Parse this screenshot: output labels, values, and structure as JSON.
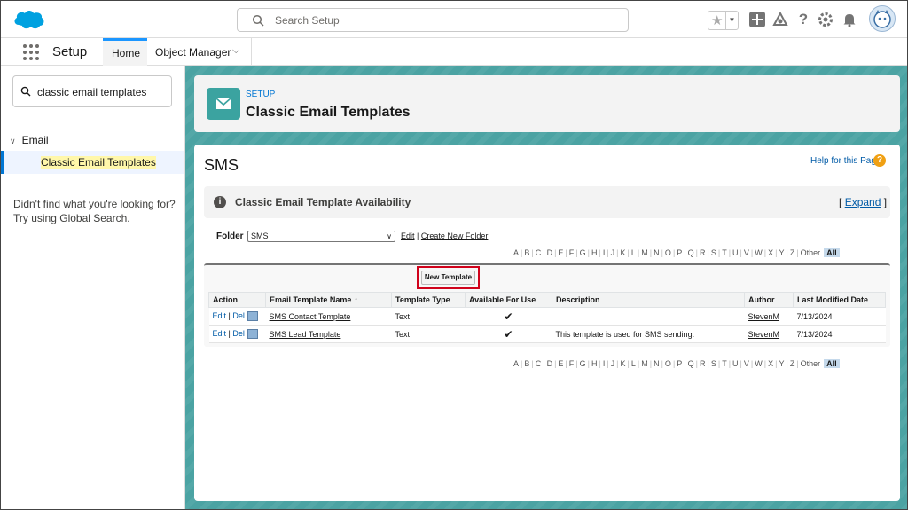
{
  "header": {
    "search_placeholder": "Search Setup"
  },
  "nav": {
    "app_title": "Setup",
    "tabs": [
      {
        "label": "Home"
      },
      {
        "label": "Object Manager"
      }
    ]
  },
  "sidebar": {
    "quick_find_value": "classic email templates",
    "group": "Email",
    "item": "Classic Email Templates",
    "not_found_line1": "Didn't find what you're looking for?",
    "not_found_line2": "Try using Global Search."
  },
  "page": {
    "eyebrow": "SETUP",
    "title": "Classic Email Templates",
    "section_title": "SMS",
    "help_link": "Help for this Page",
    "availability_title": "Classic Email Template Availability",
    "expand_open": "[",
    "expand_label": "Expand",
    "expand_close": "]",
    "folder_label": "Folder",
    "folder_value": "SMS",
    "folder_edit": "Edit",
    "folder_sep": "|",
    "folder_create": "Create New Folder",
    "new_template_label": "New Template"
  },
  "alpha": [
    "A",
    "B",
    "C",
    "D",
    "E",
    "F",
    "G",
    "H",
    "I",
    "J",
    "K",
    "L",
    "M",
    "N",
    "O",
    "P",
    "Q",
    "R",
    "S",
    "T",
    "U",
    "V",
    "W",
    "X",
    "Y",
    "Z",
    "Other",
    "All"
  ],
  "table": {
    "headers": [
      "Action",
      "Email Template Name",
      "Template Type",
      "Available For Use",
      "Description",
      "Author",
      "Last Modified Date"
    ],
    "sort_indicator": "↑",
    "action_sep": "|",
    "rows": [
      {
        "edit": "Edit",
        "del": "Del",
        "name": "SMS Contact Template",
        "type": "Text",
        "available": "✔",
        "description": "",
        "author": "StevenM",
        "modified": "7/13/2024"
      },
      {
        "edit": "Edit",
        "del": "Del",
        "name": "SMS Lead Template",
        "type": "Text",
        "available": "✔",
        "description": "This template is used for SMS sending.",
        "author": "StevenM",
        "modified": "7/13/2024"
      }
    ]
  },
  "colors": {
    "brand": "#0176d3",
    "teal_background": "#4ba3a3",
    "highlight_border": "#d0021b"
  }
}
